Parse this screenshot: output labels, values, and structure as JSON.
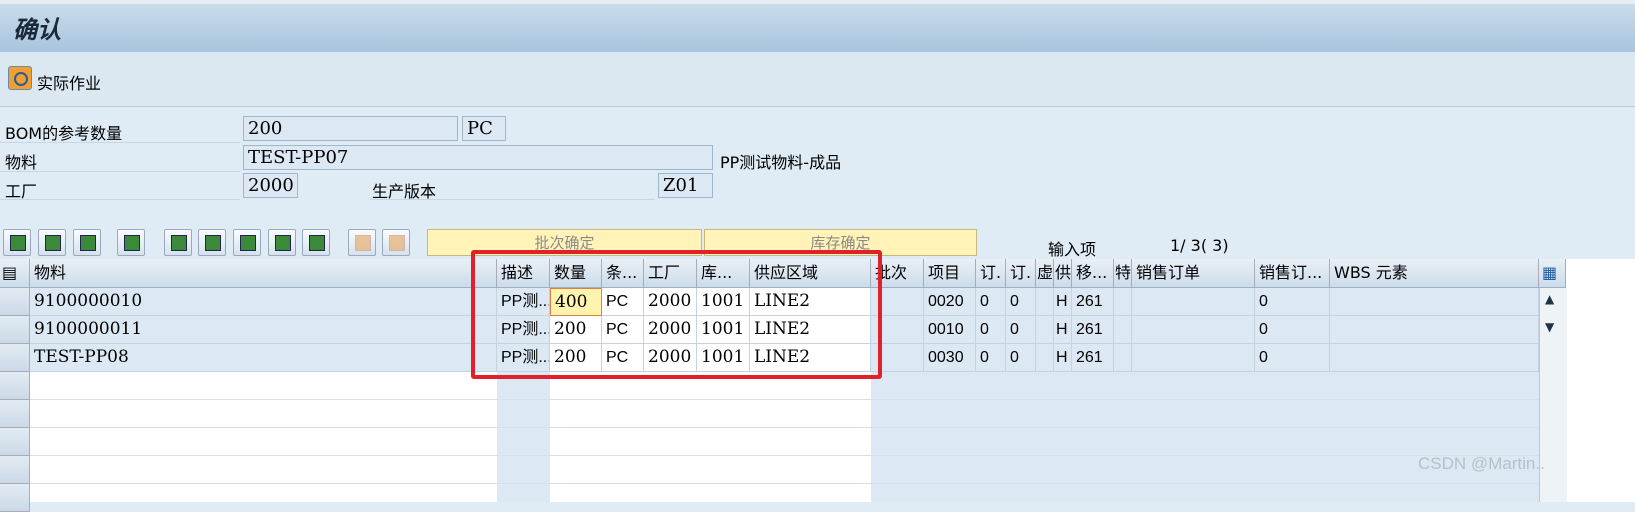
{
  "window": {
    "title": "确认"
  },
  "toolbar": {
    "action_label": "实际作业"
  },
  "header_fields": {
    "bom_ref_qty_label": "BOM的参考数量",
    "bom_ref_qty_value": "200",
    "bom_ref_qty_unit": "PC",
    "material_label": "物料",
    "material_value": "TEST-PP07",
    "material_desc": "PP测试物料-成品",
    "plant_label": "工厂",
    "plant_value": "2000",
    "prod_version_label": "生产版本",
    "prod_version_value": "Z01"
  },
  "grid_toolbar": {
    "batch_confirm_label": "批次确定",
    "stock_confirm_label": "库存确定",
    "entry_label": "输入项",
    "entry_value": "1/ 3( 3)"
  },
  "table": {
    "columns": [
      "物料",
      "描述",
      "数量",
      "条...",
      "工厂",
      "库...",
      "供应区域",
      "批次",
      "项目",
      "订.",
      "订.",
      "虚",
      "供",
      "移...",
      "特",
      "销售订单",
      "销售订...",
      "WBS 元素"
    ],
    "rows": [
      [
        "9100000010",
        "PP测...",
        "400",
        "PC",
        "2000",
        "1001",
        "LINE2",
        "",
        "0020",
        "0",
        "0",
        "",
        "H",
        "261",
        "",
        "",
        "0",
        ""
      ],
      [
        "9100000011",
        "PP测...",
        "200",
        "PC",
        "2000",
        "1001",
        "LINE2",
        "",
        "0010",
        "0",
        "0",
        "",
        "H",
        "261",
        "",
        "",
        "0",
        ""
      ],
      [
        "TEST-PP08",
        "PP测...",
        "200",
        "PC",
        "2000",
        "1001",
        "LINE2",
        "",
        "0030",
        "0",
        "0",
        "",
        "H",
        "261",
        "",
        "",
        "0",
        ""
      ]
    ]
  },
  "watermark": "CSDN @Martin..",
  "colors": {
    "highlight_box": "#e0202a",
    "active_cell": "#fff3b0"
  }
}
